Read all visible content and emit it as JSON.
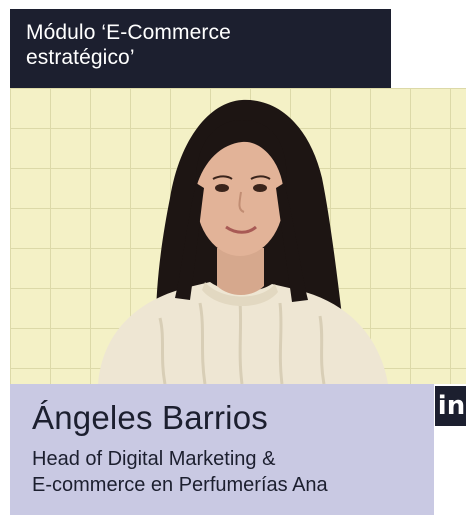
{
  "module": {
    "title_line1": "Módulo ‘E-Commerce",
    "title_line2": "estratégico’"
  },
  "speaker": {
    "name": "Ángeles Barrios",
    "role_line1": "Head of Digital Marketing &",
    "role_line2": "E-commerce en Perfumerías Ana"
  },
  "social": {
    "linkedin_glyph": "in",
    "icon": "linkedin-icon"
  },
  "colors": {
    "banner_background": "#1c1f2f",
    "photo_background": "#f4f1c6",
    "name_box_background": "#c9c9e3",
    "text_dark": "#1c1f2f"
  }
}
